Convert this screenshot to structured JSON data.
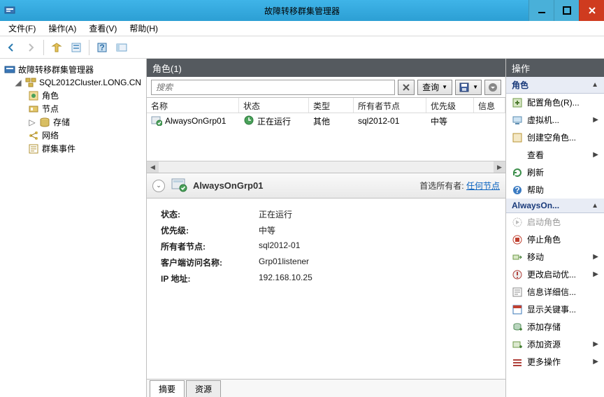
{
  "window": {
    "title": "故障转移群集管理器"
  },
  "menu": {
    "file": "文件(F)",
    "action": "操作(A)",
    "view": "查看(V)",
    "help": "帮助(H)"
  },
  "tree": {
    "root": "故障转移群集管理器",
    "cluster": "SQL2012Cluster.LONG.CN",
    "roles": "角色",
    "nodes": "节点",
    "storage": "存储",
    "network": "网络",
    "events": "群集事件"
  },
  "roles_panel": {
    "header": "角色(1)",
    "search_placeholder": "搜索",
    "query_label": "查询",
    "columns": {
      "name": "名称",
      "status": "状态",
      "type": "类型",
      "owner": "所有者节点",
      "priority": "优先级",
      "info": "信息"
    },
    "row": {
      "name": "AlwaysOnGrp01",
      "status": "正在运行",
      "type": "其他",
      "owner": "sql2012-01",
      "priority": "中等"
    }
  },
  "detail": {
    "name": "AlwaysOnGrp01",
    "pref_owner_label": "首选所有者:",
    "pref_owner_value": "任何节点",
    "status_k": "状态:",
    "status_v": "正在运行",
    "priority_k": "优先级:",
    "priority_v": "中等",
    "owner_k": "所有者节点:",
    "owner_v": "sql2012-01",
    "client_k": "客户端访问名称:",
    "client_v": "Grp01listener",
    "ip_k": "IP 地址:",
    "ip_v": "192.168.10.25",
    "tab_summary": "摘要",
    "tab_resource": "资源"
  },
  "actions": {
    "header": "操作",
    "grp_roles": "角色",
    "configure_role": "配置角色(R)...",
    "vm": "虚拟机...",
    "create_empty": "创建空角色...",
    "view": "查看",
    "refresh": "刷新",
    "help": "帮助",
    "grp_item": "AlwaysOn...",
    "start": "启动角色",
    "stop": "停止角色",
    "move": "移动",
    "change_startup": "更改启动优...",
    "detail_info": "信息详细信...",
    "show_critical": "显示关键事...",
    "add_storage": "添加存储",
    "add_resource": "添加资源",
    "more": "更多操作"
  }
}
